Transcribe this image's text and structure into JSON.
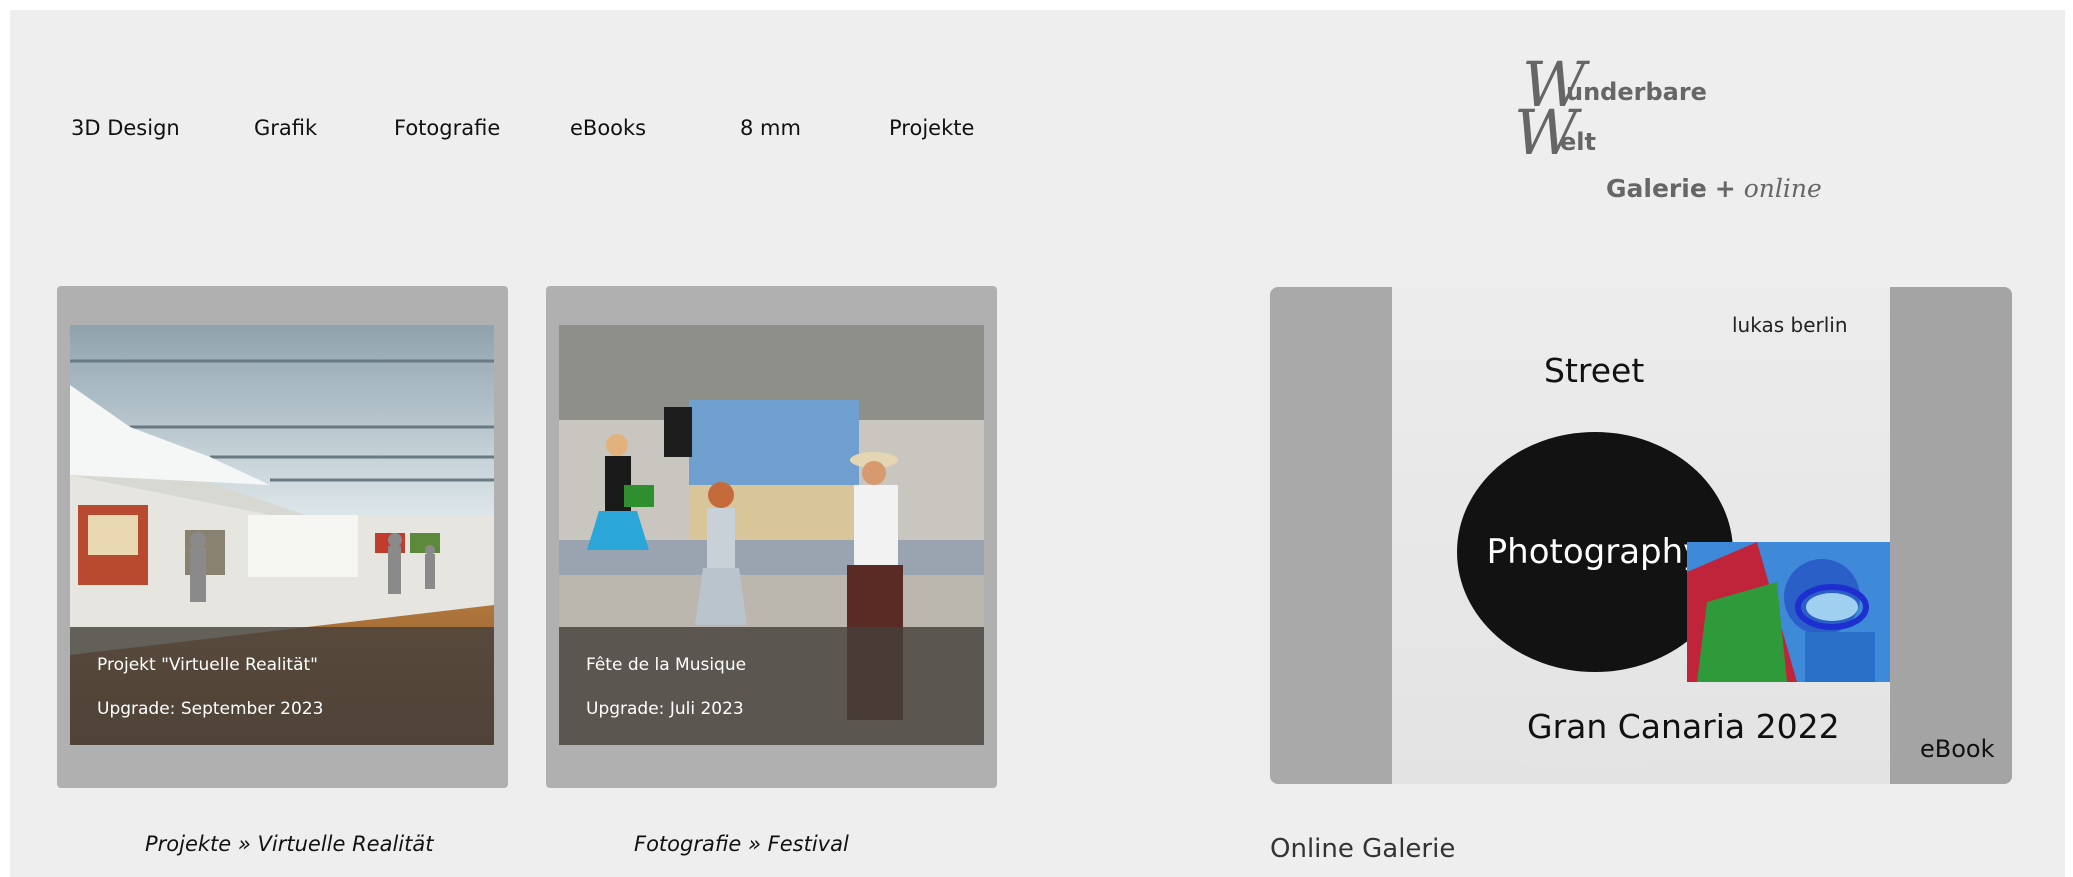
{
  "nav": {
    "items": [
      {
        "label": "3D Design"
      },
      {
        "label": "Grafik"
      },
      {
        "label": "Fotografie"
      },
      {
        "label": "eBooks"
      },
      {
        "label": "8 mm"
      },
      {
        "label": "Projekte"
      }
    ]
  },
  "logo": {
    "line1_initial": "W",
    "line1_rest": "underbare",
    "line2_initial": "W",
    "line2_rest": "elt",
    "tagline_main": "Galerie",
    "tagline_plus": "+",
    "tagline_online": "online"
  },
  "cards": [
    {
      "title": "Projekt \"Virtuelle Realität\"",
      "subtitle": "Upgrade: September 2023",
      "label": "Projekte » Virtuelle Realität",
      "image": "virtual-gallery-image"
    },
    {
      "title": "Fête de la Musique",
      "subtitle": "Upgrade: Juli 2023",
      "label": "Fotografie » Festival",
      "image": "dancing-couple-image"
    }
  ],
  "ebook": {
    "author": "lukas berlin",
    "title_top": "Street",
    "title_circle": "Photography",
    "subtitle": "Gran Canaria 2022",
    "badge": "eBook",
    "label": "Online Galerie"
  },
  "colors": {
    "page_background": "#eeeeee",
    "card_frame": "#b0b0b0",
    "logo_gray": "#666666",
    "text": "#111111"
  }
}
